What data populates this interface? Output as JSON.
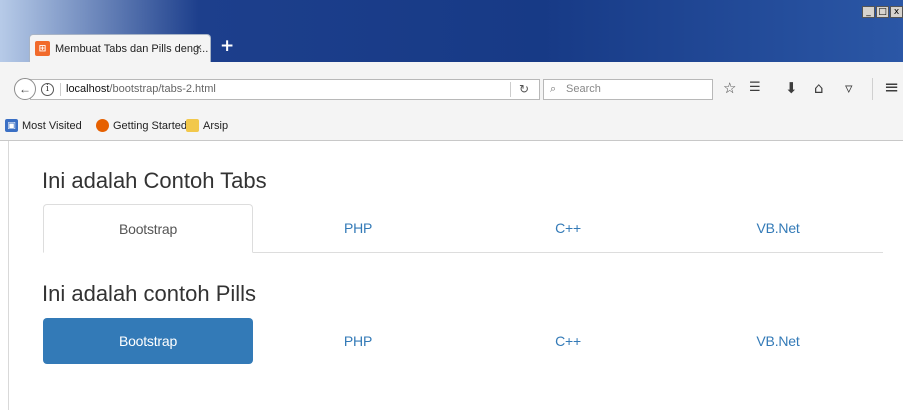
{
  "browser": {
    "tab": {
      "title": "Membuat Tabs dan Pills deng...",
      "close": "×",
      "favicon": "⊞"
    },
    "new_tab": "+",
    "window_controls": {
      "minimize": "_",
      "maximize": "□",
      "close": "x"
    },
    "nav": {
      "back": "←",
      "info": "i",
      "url_host": "localhost",
      "url_path": "/bootstrap/tabs-2.html",
      "reload": "↻",
      "search_placeholder": "Search",
      "search_glyph": "⌕",
      "icons": {
        "bookmark_star": "☆",
        "reading_list": "☰",
        "download": "⬇",
        "home": "⌂",
        "pocket": "▿",
        "menu": "≡"
      }
    },
    "bookmarks": [
      {
        "label": "Most Visited",
        "icon": "most-visited-icon",
        "color": "#3a6fc4"
      },
      {
        "label": "Getting Started",
        "icon": "firefox-icon",
        "color": "#e66000"
      },
      {
        "label": "Arsip",
        "icon": "folder-icon",
        "color": "#f2c84b"
      }
    ]
  },
  "page": {
    "tabs_heading": "Ini adalah Contoh Tabs",
    "tabs": [
      "Bootstrap",
      "PHP",
      "C++",
      "VB.Net"
    ],
    "tabs_active_index": 0,
    "pills_heading": "Ini adalah contoh Pills",
    "pills": [
      "Bootstrap",
      "PHP",
      "C++",
      "VB.Net"
    ],
    "pills_active_index": 0
  },
  "colors": {
    "link": "#337ab7",
    "active_pill_bg": "#337ab7",
    "titlebar": "#1d3f8c"
  }
}
